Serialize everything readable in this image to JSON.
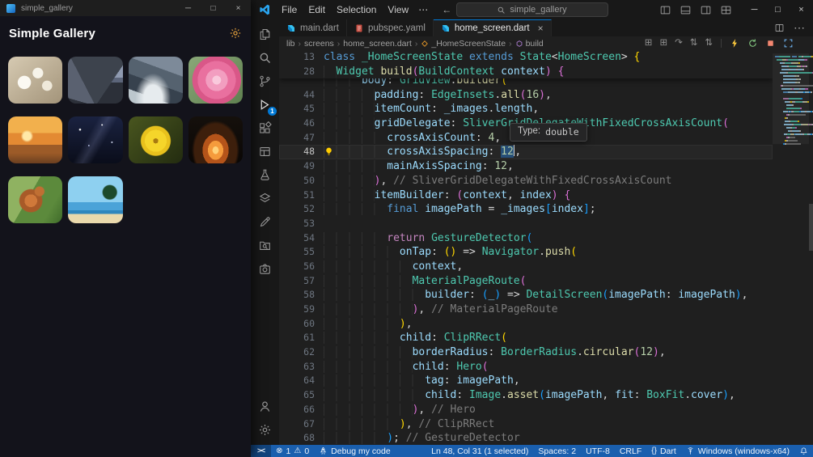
{
  "colors": {
    "accent": "#0078d4",
    "status_bg": "#1a5fae",
    "kw": "#569cd6",
    "ctl": "#c586c0",
    "cls": "#4ec9b0",
    "fn": "#dcdcaa",
    "prop": "#9cdcfe",
    "num": "#b5cea8",
    "cmt": "#7c7c7c",
    "pun": "#d4d4d4",
    "b1": "#ffd700",
    "b2": "#da70d6",
    "b3": "#179fff",
    "sel": "#264f78"
  },
  "controls": {
    "min": "─",
    "max": "□",
    "close": "×"
  },
  "app_window": {
    "titlebar": {
      "title": "simple_gallery"
    },
    "header": {
      "title": "Simple Gallery"
    },
    "images": [
      {
        "name": "white-flowers"
      },
      {
        "name": "road"
      },
      {
        "name": "mountain-cliff"
      },
      {
        "name": "pink-rose"
      },
      {
        "name": "sunset-beach"
      },
      {
        "name": "starry-night"
      },
      {
        "name": "yellow-flower"
      },
      {
        "name": "campfire"
      },
      {
        "name": "squirrel"
      },
      {
        "name": "palm-beach"
      }
    ]
  },
  "vscode": {
    "titlebar": {
      "menus": [
        "File",
        "Edit",
        "Selection",
        "View"
      ],
      "overflow": "⋯",
      "nav_back": "←",
      "nav_forward": "→",
      "search_text": "simple_gallery"
    },
    "tabs": [
      {
        "label": "main.dart",
        "icon": "dart"
      },
      {
        "label": "pubspec.yaml",
        "icon": "pubspec"
      },
      {
        "label": "home_screen.dart",
        "icon": "dart",
        "active": true,
        "close": "×"
      }
    ],
    "tab_actions_more": "⋯",
    "breadcrumb": [
      {
        "label": "lib"
      },
      {
        "label": "screens"
      },
      {
        "label": "home_screen.dart"
      },
      {
        "label": "_HomeScreenState",
        "icon": "class-sym"
      },
      {
        "label": "build",
        "icon": "method-sym"
      }
    ],
    "breadcrumb_sep": "›",
    "editor_actions": {
      "gray": [
        "⊞",
        "⊞",
        "↷",
        "⇅",
        "⇅"
      ],
      "colored": [
        "hot-reload",
        "hot-restart",
        "stop",
        "detach"
      ]
    },
    "activity_bar": {
      "top": [
        {
          "name": "explorer"
        },
        {
          "name": "search"
        },
        {
          "name": "source-control"
        },
        {
          "name": "run-debug",
          "badge": "1",
          "active": true
        },
        {
          "name": "extensions"
        },
        {
          "name": "table"
        },
        {
          "name": "testing"
        },
        {
          "name": "layers"
        },
        {
          "name": "edit"
        },
        {
          "name": "folder-search"
        },
        {
          "name": "screenshot"
        }
      ],
      "bottom": [
        {
          "name": "account"
        },
        {
          "name": "settings"
        }
      ]
    },
    "editor": {
      "sticky_lines": [
        {
          "n": "13",
          "segs": [
            [
              "class ",
              "kw"
            ],
            [
              "_HomeScreenState",
              "cls"
            ],
            [
              " ",
              "pun"
            ],
            [
              "extends",
              "kw"
            ],
            [
              " ",
              "pun"
            ],
            [
              "State",
              "cls"
            ],
            [
              "<",
              "pun"
            ],
            [
              "HomeScreen",
              "cls"
            ],
            [
              ">",
              "pun"
            ],
            [
              " {",
              "b1"
            ]
          ]
        },
        {
          "n": "28",
          "segs": [
            [
              "  ",
              "pun"
            ],
            [
              "Widget ",
              "cls"
            ],
            [
              "build",
              "fn"
            ],
            [
              "(",
              "b2"
            ],
            [
              "BuildContext ",
              "cls"
            ],
            [
              "context",
              "prop"
            ],
            [
              ")",
              "b2"
            ],
            [
              " {",
              "b2"
            ]
          ]
        }
      ],
      "code_lines": [
        {
          "n": "",
          "segs": [
            [
              "      ",
              "pun"
            ],
            [
              "body",
              "prop"
            ],
            [
              ": ",
              "pun"
            ],
            [
              "GridView",
              "cls"
            ],
            [
              ".",
              "pun"
            ],
            [
              "builder",
              "fn"
            ],
            [
              "(",
              "b1"
            ]
          ]
        },
        {
          "n": "44",
          "segs": [
            [
              "        ",
              "pun"
            ],
            [
              "padding",
              "prop"
            ],
            [
              ": ",
              "pun"
            ],
            [
              "EdgeInsets",
              "cls"
            ],
            [
              ".",
              "pun"
            ],
            [
              "all",
              "fn"
            ],
            [
              "(",
              "b2"
            ],
            [
              "16",
              "num"
            ],
            [
              ")",
              "b2"
            ],
            [
              ",",
              "pun"
            ]
          ]
        },
        {
          "n": "45",
          "segs": [
            [
              "        ",
              "pun"
            ],
            [
              "itemCount",
              "prop"
            ],
            [
              ": ",
              "pun"
            ],
            [
              "_images",
              "prop"
            ],
            [
              ".",
              "pun"
            ],
            [
              "length",
              "prop"
            ],
            [
              ",",
              "pun"
            ]
          ]
        },
        {
          "n": "46",
          "segs": [
            [
              "        ",
              "pun"
            ],
            [
              "gridDelegate",
              "prop"
            ],
            [
              ": ",
              "pun"
            ],
            [
              "SliverGridDelegateWithFixedCrossAxisCount",
              "cls"
            ],
            [
              "(",
              "b2"
            ]
          ]
        },
        {
          "n": "47",
          "segs": [
            [
              "          ",
              "pun"
            ],
            [
              "crossAxisCount",
              "prop"
            ],
            [
              ": ",
              "pun"
            ],
            [
              "4",
              "num"
            ],
            [
              ",",
              "pun"
            ]
          ]
        },
        {
          "n": "48",
          "cur": true,
          "segs": [
            [
              "          ",
              "pun"
            ],
            [
              "crossAxisSpacing",
              "prop"
            ],
            [
              ": ",
              "pun"
            ],
            [
              "12",
              "num",
              "sel"
            ],
            [
              "",
              "cur"
            ],
            [
              ",",
              "pun"
            ]
          ]
        },
        {
          "n": "49",
          "segs": [
            [
              "          ",
              "pun"
            ],
            [
              "mainAxisSpacing",
              "prop"
            ],
            [
              ": ",
              "pun"
            ],
            [
              "12",
              "num"
            ],
            [
              ",",
              "pun"
            ]
          ]
        },
        {
          "n": "50",
          "segs": [
            [
              "        ",
              "pun"
            ],
            [
              ")",
              "b2"
            ],
            [
              ", ",
              "pun"
            ],
            [
              "// SliverGridDelegateWithFixedCrossAxisCount",
              "cmt"
            ]
          ]
        },
        {
          "n": "51",
          "segs": [
            [
              "        ",
              "pun"
            ],
            [
              "itemBuilder",
              "prop"
            ],
            [
              ": ",
              "pun"
            ],
            [
              "(",
              "b2"
            ],
            [
              "context",
              "prop"
            ],
            [
              ", ",
              "pun"
            ],
            [
              "index",
              "prop"
            ],
            [
              ")",
              "b2"
            ],
            [
              " {",
              "b2"
            ]
          ]
        },
        {
          "n": "52",
          "segs": [
            [
              "          ",
              "pun"
            ],
            [
              "final ",
              "kw"
            ],
            [
              "imagePath",
              "prop"
            ],
            [
              " = ",
              "pun"
            ],
            [
              "_images",
              "prop"
            ],
            [
              "[",
              "b3"
            ],
            [
              "index",
              "prop"
            ],
            [
              "]",
              "b3"
            ],
            [
              ";",
              "pun"
            ]
          ]
        },
        {
          "n": "53",
          "segs": []
        },
        {
          "n": "54",
          "segs": [
            [
              "          ",
              "pun"
            ],
            [
              "return ",
              "ctl"
            ],
            [
              "GestureDetector",
              "cls"
            ],
            [
              "(",
              "b3"
            ]
          ]
        },
        {
          "n": "55",
          "segs": [
            [
              "            ",
              "pun"
            ],
            [
              "onTap",
              "prop"
            ],
            [
              ": ",
              "pun"
            ],
            [
              "()",
              "b1"
            ],
            [
              " => ",
              "pun"
            ],
            [
              "Navigator",
              "cls"
            ],
            [
              ".",
              "pun"
            ],
            [
              "push",
              "fn"
            ],
            [
              "(",
              "b1"
            ]
          ]
        },
        {
          "n": "56",
          "segs": [
            [
              "              ",
              "pun"
            ],
            [
              "context",
              "prop"
            ],
            [
              ",",
              "pun"
            ]
          ]
        },
        {
          "n": "57",
          "segs": [
            [
              "              ",
              "pun"
            ],
            [
              "MaterialPageRoute",
              "cls"
            ],
            [
              "(",
              "b2"
            ]
          ]
        },
        {
          "n": "58",
          "segs": [
            [
              "                ",
              "pun"
            ],
            [
              "builder",
              "prop"
            ],
            [
              ": ",
              "pun"
            ],
            [
              "(",
              "b3"
            ],
            [
              "_",
              "prop"
            ],
            [
              ")",
              "b3"
            ],
            [
              " => ",
              "pun"
            ],
            [
              "DetailScreen",
              "cls"
            ],
            [
              "(",
              "b3"
            ],
            [
              "imagePath",
              "prop"
            ],
            [
              ": ",
              "pun"
            ],
            [
              "imagePath",
              "prop"
            ],
            [
              ")",
              "b3"
            ],
            [
              ",",
              "pun"
            ]
          ]
        },
        {
          "n": "59",
          "segs": [
            [
              "              ",
              "pun"
            ],
            [
              ")",
              "b2"
            ],
            [
              ", ",
              "pun"
            ],
            [
              "// MaterialPageRoute",
              "cmt"
            ]
          ]
        },
        {
          "n": "60",
          "segs": [
            [
              "            ",
              "pun"
            ],
            [
              ")",
              "b1"
            ],
            [
              ",",
              "pun"
            ]
          ]
        },
        {
          "n": "61",
          "segs": [
            [
              "            ",
              "pun"
            ],
            [
              "child",
              "prop"
            ],
            [
              ": ",
              "pun"
            ],
            [
              "ClipRRect",
              "cls"
            ],
            [
              "(",
              "b1"
            ]
          ]
        },
        {
          "n": "62",
          "segs": [
            [
              "              ",
              "pun"
            ],
            [
              "borderRadius",
              "prop"
            ],
            [
              ": ",
              "pun"
            ],
            [
              "BorderRadius",
              "cls"
            ],
            [
              ".",
              "pun"
            ],
            [
              "circular",
              "fn"
            ],
            [
              "(",
              "b2"
            ],
            [
              "12",
              "num"
            ],
            [
              ")",
              "b2"
            ],
            [
              ",",
              "pun"
            ]
          ]
        },
        {
          "n": "63",
          "segs": [
            [
              "              ",
              "pun"
            ],
            [
              "child",
              "prop"
            ],
            [
              ": ",
              "pun"
            ],
            [
              "Hero",
              "cls"
            ],
            [
              "(",
              "b2"
            ]
          ]
        },
        {
          "n": "64",
          "segs": [
            [
              "                ",
              "pun"
            ],
            [
              "tag",
              "prop"
            ],
            [
              ": ",
              "pun"
            ],
            [
              "imagePath",
              "prop"
            ],
            [
              ",",
              "pun"
            ]
          ]
        },
        {
          "n": "65",
          "segs": [
            [
              "                ",
              "pun"
            ],
            [
              "child",
              "prop"
            ],
            [
              ": ",
              "pun"
            ],
            [
              "Image",
              "cls"
            ],
            [
              ".",
              "pun"
            ],
            [
              "asset",
              "fn"
            ],
            [
              "(",
              "b3"
            ],
            [
              "imagePath",
              "prop"
            ],
            [
              ", ",
              "pun"
            ],
            [
              "fit",
              "prop"
            ],
            [
              ": ",
              "pun"
            ],
            [
              "BoxFit",
              "cls"
            ],
            [
              ".",
              "pun"
            ],
            [
              "cover",
              "prop"
            ],
            [
              ")",
              "b3"
            ],
            [
              ",",
              "pun"
            ]
          ]
        },
        {
          "n": "66",
          "segs": [
            [
              "              ",
              "pun"
            ],
            [
              ")",
              "b2"
            ],
            [
              ", ",
              "pun"
            ],
            [
              "// Hero",
              "cmt"
            ]
          ]
        },
        {
          "n": "67",
          "segs": [
            [
              "            ",
              "pun"
            ],
            [
              ")",
              "b1"
            ],
            [
              ", ",
              "pun"
            ],
            [
              "// ClipRRect",
              "cmt"
            ]
          ]
        },
        {
          "n": "68",
          "segs": [
            [
              "          ",
              "pun"
            ],
            [
              ")",
              "b3"
            ],
            [
              "; ",
              "pun"
            ],
            [
              "// GestureDetector",
              "cmt"
            ]
          ]
        }
      ],
      "tooltip": {
        "label": "Type:",
        "value": "double"
      }
    },
    "status_bar": {
      "errors": "1",
      "warnings": "0",
      "error_glyph": "⊗",
      "warning_glyph": "⚠",
      "task": "Debug my code",
      "cursor": "Ln 48, Col 31 (1 selected)",
      "indent": "Spaces: 2",
      "encoding": "UTF-8",
      "eol": "CRLF",
      "lang_glyph": "{}",
      "lang": "Dart",
      "device": "Windows (windows-x64)"
    }
  }
}
